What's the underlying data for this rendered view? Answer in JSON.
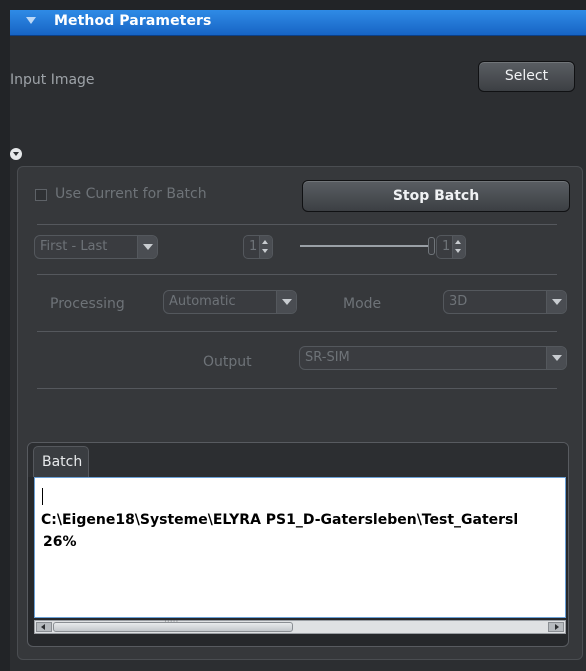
{
  "section": {
    "title": "Method Parameters"
  },
  "input_image": {
    "label": "Input Image",
    "select_label": "Select"
  },
  "batch_controls": {
    "use_current_label": "Use Current for Batch",
    "use_current_checked": false,
    "stop_batch_label": "Stop Batch",
    "range_mode": "First - Last",
    "range_start": "1",
    "range_end": "1"
  },
  "processing": {
    "label": "Processing",
    "value": "Automatic",
    "mode_label": "Mode",
    "mode_value": "3D",
    "output_label": "Output",
    "output_value": "SR-SIM"
  },
  "batch_tab": {
    "label": "Batch",
    "log_path": "C:\\Eigene18\\Systeme\\ELYRA PS1_D-Gatersleben\\Test_Gatersl",
    "progress_text": "26%"
  },
  "icons": {
    "collapse": "triangle-down-icon",
    "expand": "circle-chevron-down-icon",
    "dropdown": "chevron-down-icon",
    "spinner": "spin-arrows-icon"
  },
  "colors": {
    "header_blue": "#1f6fd6",
    "panel_dark": "#2c2e31"
  }
}
